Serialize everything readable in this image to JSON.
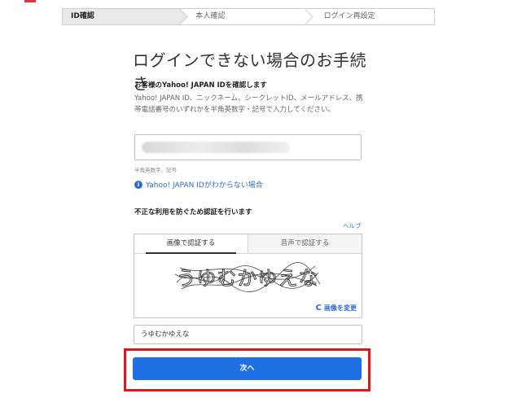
{
  "steps": [
    "ID確認",
    "本人確認",
    "ログイン再設定"
  ],
  "title": "ログインできない場合のお手続き",
  "id_section": {
    "heading": "お客様のYahoo! JAPAN IDを確認します",
    "description": "Yahoo! JAPAN ID、ニックネーム、シークレットID、メールアドレス、携帯電話番号のいずれかを半角英数字・記号で入力してください。",
    "hint": "半角英数字、記号",
    "forgot_link": "Yahoo! JAPAN IDがわからない場合",
    "info_icon": "i"
  },
  "verify_section": {
    "heading": "不正な利用を防ぐため認証を行います",
    "help": "ヘルプ",
    "tabs": [
      "画像で認証する",
      "音声で認証する"
    ],
    "captcha_text": "うゆむかゆえな",
    "refresh_label": "画像を変更",
    "refresh_icon": "C",
    "answer_value": "うゆむかゆえな"
  },
  "next_label": "次へ",
  "colors": {
    "accent": "#1f6fe5",
    "highlight": "#e0161c",
    "link": "#2f6cc9"
  }
}
